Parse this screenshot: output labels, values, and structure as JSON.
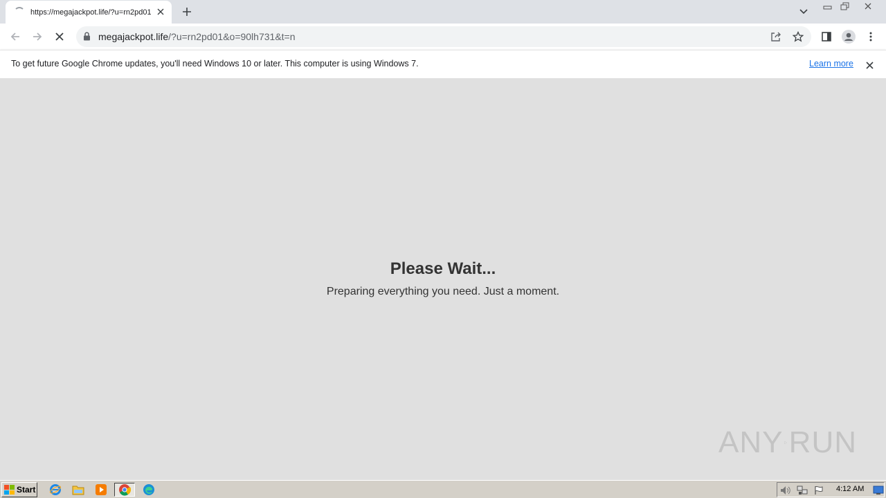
{
  "browser": {
    "tab": {
      "title": "https://megajackpot.life/?u=rn2pd01&o=90lh731&t=n"
    },
    "address": {
      "host": "megajackpot.life",
      "path": "/?u=rn2pd01&o=90lh731&t=n"
    }
  },
  "infobar": {
    "message": "To get future Google Chrome updates, you'll need Windows 10 or later. This computer is using Windows 7.",
    "link": "Learn more"
  },
  "page": {
    "headline": "Please Wait...",
    "subline": "Preparing everything you need. Just a moment."
  },
  "watermark": {
    "left": "ANY",
    "right": "RUN"
  },
  "taskbar": {
    "start_label": "Start",
    "clock": "4:12 AM",
    "apps": [
      "internet-explorer-icon",
      "file-explorer-icon",
      "media-player-icon",
      "chrome-icon",
      "edge-icon"
    ]
  },
  "colors": {
    "link": "#1a73e8",
    "page_bg": "#e0e0e0",
    "text": "#333333"
  }
}
